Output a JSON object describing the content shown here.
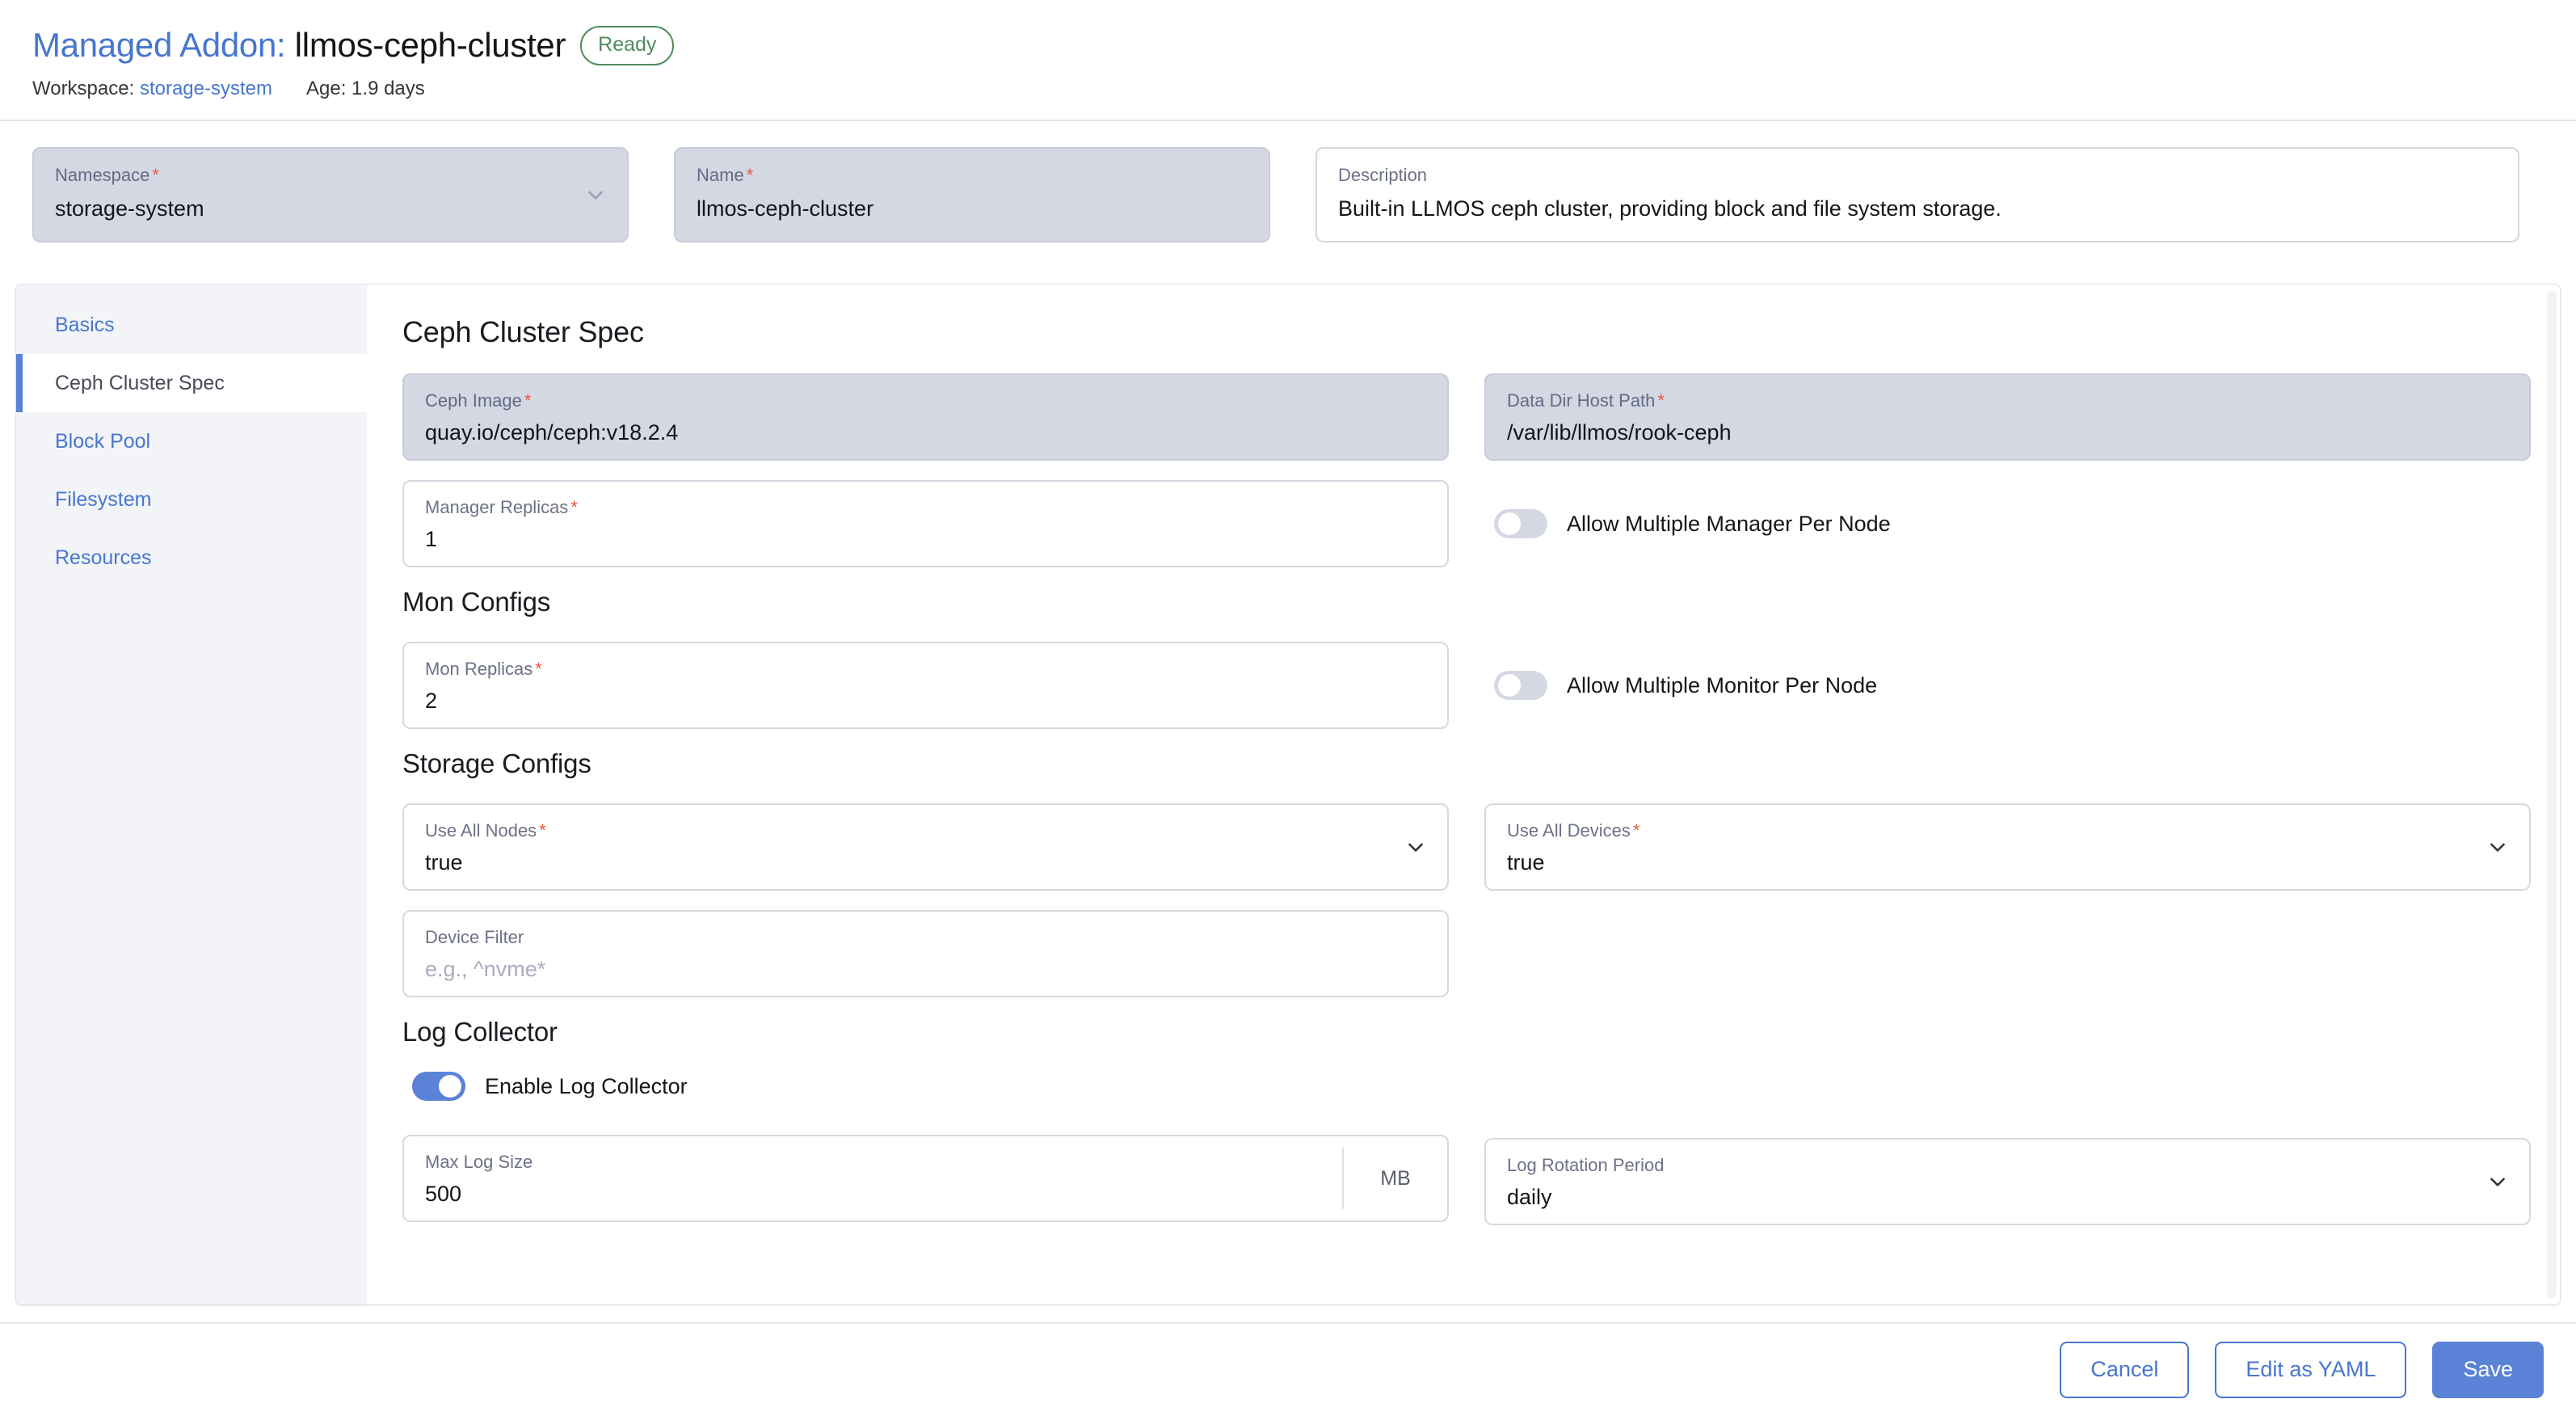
{
  "header": {
    "title_prefix": "Managed Addon:",
    "title_name": "llmos-ceph-cluster",
    "status": "Ready",
    "workspace_label": "Workspace:",
    "workspace_value": "storage-system",
    "age": "Age: 1.9 days"
  },
  "top_fields": {
    "namespace": {
      "label": "Namespace",
      "value": "storage-system",
      "required": true
    },
    "name": {
      "label": "Name",
      "value": "llmos-ceph-cluster",
      "required": true
    },
    "description": {
      "label": "Description",
      "value": "Built-in LLMOS ceph cluster, providing block and file system storage."
    }
  },
  "sidebar": {
    "items": [
      {
        "label": "Basics"
      },
      {
        "label": "Ceph Cluster Spec"
      },
      {
        "label": "Block Pool"
      },
      {
        "label": "Filesystem"
      },
      {
        "label": "Resources"
      }
    ]
  },
  "main": {
    "heading": "Ceph Cluster Spec",
    "ceph_image": {
      "label": "Ceph Image",
      "value": "quay.io/ceph/ceph:v18.2.4"
    },
    "data_dir_host_path": {
      "label": "Data Dir Host Path",
      "value": "/var/lib/llmos/rook-ceph"
    },
    "manager_replicas": {
      "label": "Manager Replicas",
      "value": "1"
    },
    "allow_multiple_manager": {
      "label": "Allow Multiple Manager Per Node",
      "value": "off"
    },
    "mon_configs_heading": "Mon Configs",
    "mon_replicas": {
      "label": "Mon Replicas",
      "value": "2"
    },
    "allow_multiple_monitor": {
      "label": "Allow Multiple Monitor Per Node",
      "value": "off"
    },
    "storage_configs_heading": "Storage Configs",
    "use_all_nodes": {
      "label": "Use All Nodes",
      "value": "true"
    },
    "use_all_devices": {
      "label": "Use All Devices",
      "value": "true"
    },
    "device_filter": {
      "label": "Device Filter",
      "value": "",
      "placeholder": "e.g., ^nvme*"
    },
    "log_collector_heading": "Log Collector",
    "enable_log_collector": {
      "label": "Enable Log Collector",
      "value": "on"
    },
    "max_log_size": {
      "label": "Max Log Size",
      "value": "500",
      "unit": "MB"
    },
    "log_rotation_period": {
      "label": "Log Rotation Period",
      "value": "daily"
    }
  },
  "footer": {
    "cancel": "Cancel",
    "edit_yaml": "Edit as YAML",
    "save": "Save"
  },
  "colors": {
    "accent": "#4776cf",
    "primary_button": "#5a82d6",
    "status_green": "#4f8c58",
    "required_red": "#e8593f",
    "disabled_bg": "#d4d8e2",
    "sidebar_bg": "#f2f4f8"
  }
}
